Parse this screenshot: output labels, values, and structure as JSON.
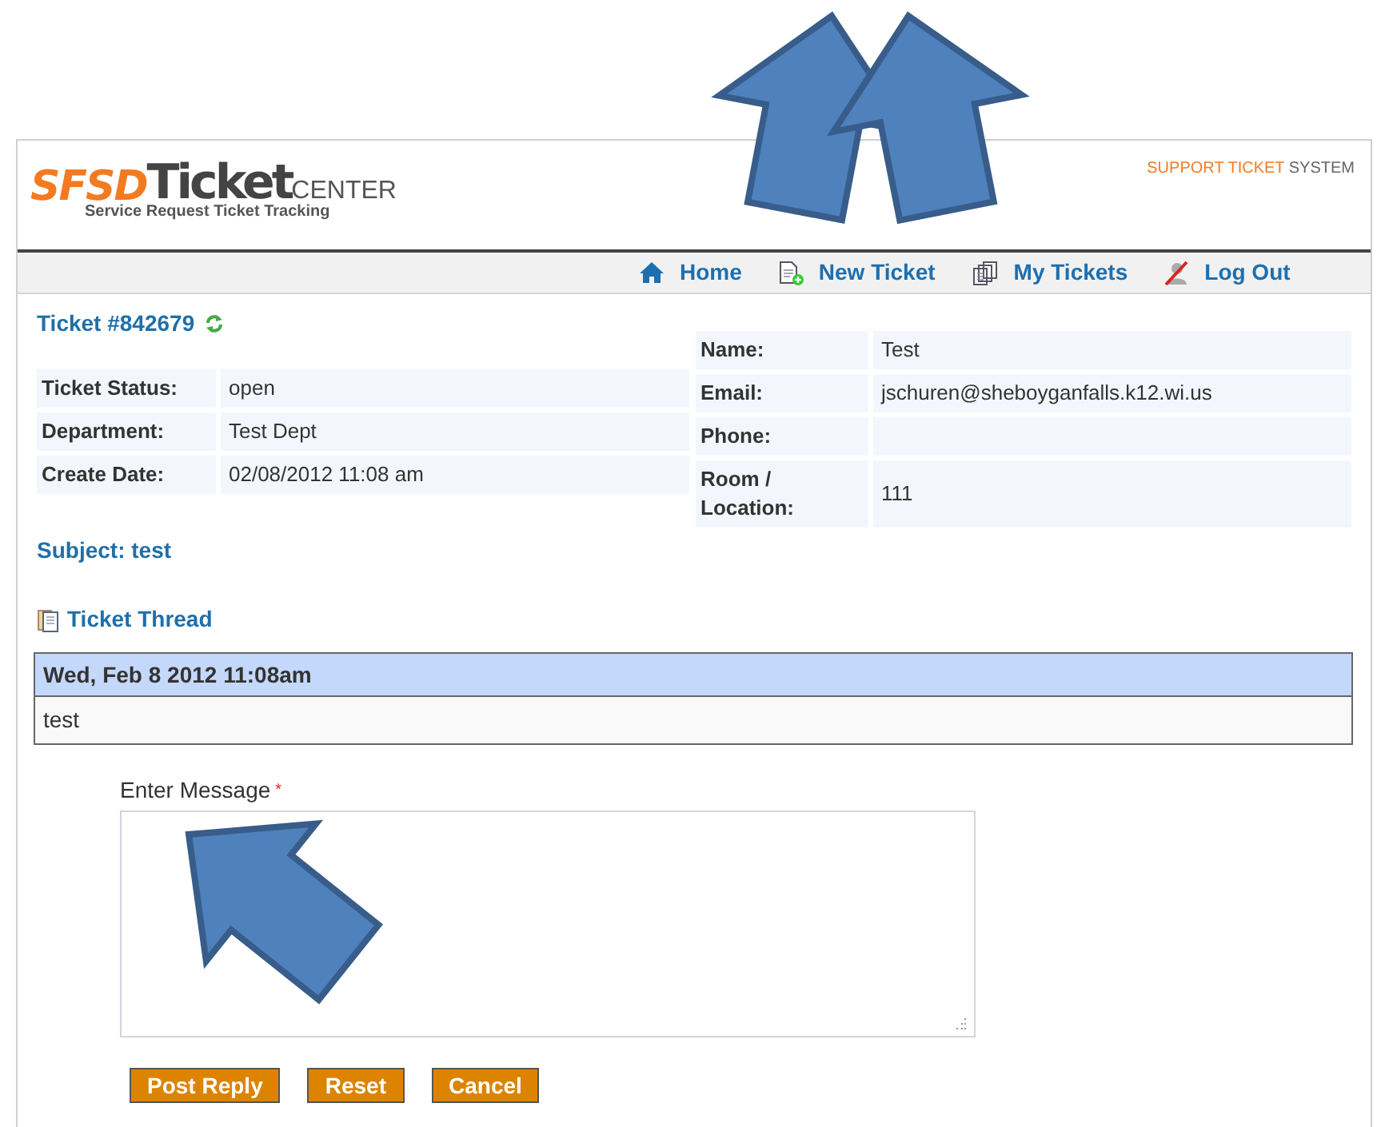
{
  "header": {
    "logo": {
      "brand": "SFSD",
      "title": "Ticket",
      "suffix": "CENTER",
      "tagline": "Service Request Ticket Tracking"
    },
    "system_label": {
      "highlight": "SUPPORT TICKET",
      "rest": "SYSTEM"
    }
  },
  "nav": [
    {
      "label": "Home",
      "kind": "home"
    },
    {
      "label": "New Ticket",
      "kind": "new"
    },
    {
      "label": "My Tickets",
      "kind": "list"
    },
    {
      "label": "Log Out",
      "kind": "logout"
    }
  ],
  "ticket": {
    "title": "Ticket #842679",
    "details": [
      {
        "label": "Ticket Status:",
        "value": "open"
      },
      {
        "label": "Department:",
        "value": "Test Dept"
      },
      {
        "label": "Create Date:",
        "value": "02/08/2012 11:08 am"
      }
    ],
    "contact": [
      {
        "label": "Name:",
        "value": "Test"
      },
      {
        "label": "Email:",
        "value": "jschuren@sheboyganfalls.k12.wi.us"
      },
      {
        "label": "Phone:"
      },
      {
        "label": "Room / Location:",
        "value": "111"
      }
    ],
    "subject": "Subject: test"
  },
  "thread": {
    "title": "Ticket Thread",
    "messages": [
      {
        "date": "Wed, Feb 8 2012 11:08am",
        "body": "test"
      }
    ]
  },
  "reply": {
    "label": "Enter Message",
    "required_mark": "*",
    "buttons": [
      "Post Reply",
      "Reset",
      "Cancel"
    ]
  }
}
